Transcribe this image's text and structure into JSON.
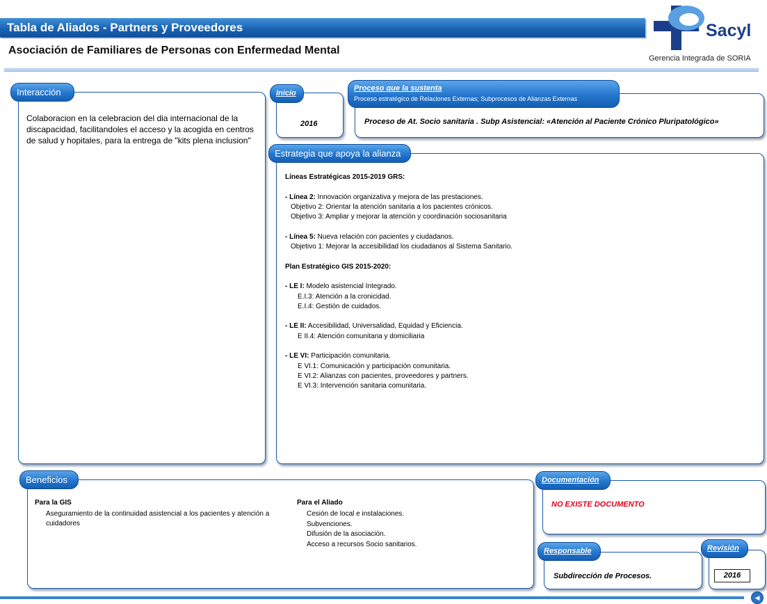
{
  "header": {
    "title": "Tabla de Aliados - Partners y Proveedores",
    "subtitle": "Asociación de Familiares de Personas con Enfermedad Mental",
    "logo_text": "Sacyl",
    "logo_subtitle": "Gerencia Integrada de SORIA"
  },
  "interaccion": {
    "label": "Interacción",
    "text": "Colaboracion en la celebracion del dia internacional de la discapacidad, facilitandoles el acceso y la acogida en centros de salud y hopitales, para la entrega de \"kits plena inclusion\""
  },
  "inicio": {
    "label": "Inicio",
    "value": "2016"
  },
  "proceso": {
    "label": "Proceso que la sustenta",
    "sublabel": "Proceso estratégico de Relaciones Externas; Subprocesos de Alianzas Externas",
    "value": "Proceso de At. Socio sanitaria . Subp Asistencial: «Atención al Paciente Crónico Pluripatológico»"
  },
  "estrategia": {
    "label": "Estrategia que apoya la alianza",
    "lines": [
      {
        "bold": "Líneas Estratégicas 2015-2019  GRS:",
        "text": "",
        "indent": 0
      },
      {
        "bold": "",
        "text": "",
        "indent": 0
      },
      {
        "bold": "- Línea 2:",
        "text": " Innovación organizativa y mejora de las prestaciones.",
        "indent": 0
      },
      {
        "bold": "",
        "text": "Objetivo 2: Orientar la atención sanitaria a los pacientes crónicos.",
        "indent": 1
      },
      {
        "bold": "",
        "text": "Objetivo 3: Ampliar y mejorar la atención y coordinación sociosanitaria",
        "indent": 1
      },
      {
        "bold": "",
        "text": "",
        "indent": 0
      },
      {
        "bold": "- Línea 5:",
        "text": " Nueva relación con pacientes y ciudadanos.",
        "indent": 0
      },
      {
        "bold": "",
        "text": "Objetivo 1: Mejorar la accesibilidad los ciudadanos al Sistema Sanitario.",
        "indent": 1
      },
      {
        "bold": "",
        "text": "",
        "indent": 0
      },
      {
        "bold": " Plan Estratégico GIS 2015-2020:",
        "text": "",
        "indent": 0
      },
      {
        "bold": "",
        "text": "",
        "indent": 0
      },
      {
        "bold": "- LE I:",
        "text": " Modelo asistencial Integrado.",
        "indent": 0
      },
      {
        "bold": "",
        "text": "E.I.3: Atención a la cronicidad.",
        "indent": 2
      },
      {
        "bold": "",
        "text": "E.I.4: Gestión de cuidados.",
        "indent": 2
      },
      {
        "bold": "",
        "text": "",
        "indent": 0
      },
      {
        "bold": "- LE II:",
        "text": " Accesibilidad, Universalidad, Equidad y Eficiencia.",
        "indent": 0
      },
      {
        "bold": "",
        "text": "E II.4: Atención comunitaria y domiciliaria",
        "indent": 2
      },
      {
        "bold": "",
        "text": "",
        "indent": 0
      },
      {
        "bold": "- LE VI:",
        "text": " Participación comunitaria.",
        "indent": 0
      },
      {
        "bold": "",
        "text": "E VI.1: Comunicación y participación comunitaria.",
        "indent": 2
      },
      {
        "bold": "",
        "text": "E VI.2: Alianzas con pacientes, proveedores y partners.",
        "indent": 2
      },
      {
        "bold": "",
        "text": "E VI.3: Intervención sanitaria comunitaria.",
        "indent": 2
      }
    ]
  },
  "beneficios": {
    "label": "Beneficios",
    "gis_title": "Para la GIS",
    "gis_text": "Aseguramiento de la continuidad asistencial a los pacientes y atención a cuidadores",
    "aliado_title": "Para el Aliado",
    "aliado_items": [
      "Cesión de local e instalaciones.",
      "Subvenciones.",
      "Difusión de la asociación.",
      "Acceso a recursos Socio sanitarios."
    ]
  },
  "documentacion": {
    "label": "Documentación",
    "value": "NO EXISTE DOCUMENTO"
  },
  "responsable": {
    "label": "Responsable",
    "value": "Subdirección de Procesos."
  },
  "revision": {
    "label": "Revisión",
    "value": "2016"
  },
  "colors": {
    "primary": "#1b63b3",
    "border": "#1a5aa8",
    "alert": "#e0001b"
  },
  "icons": {
    "back": "back-arrow-icon",
    "logo": "sacyl-cross-logo"
  }
}
